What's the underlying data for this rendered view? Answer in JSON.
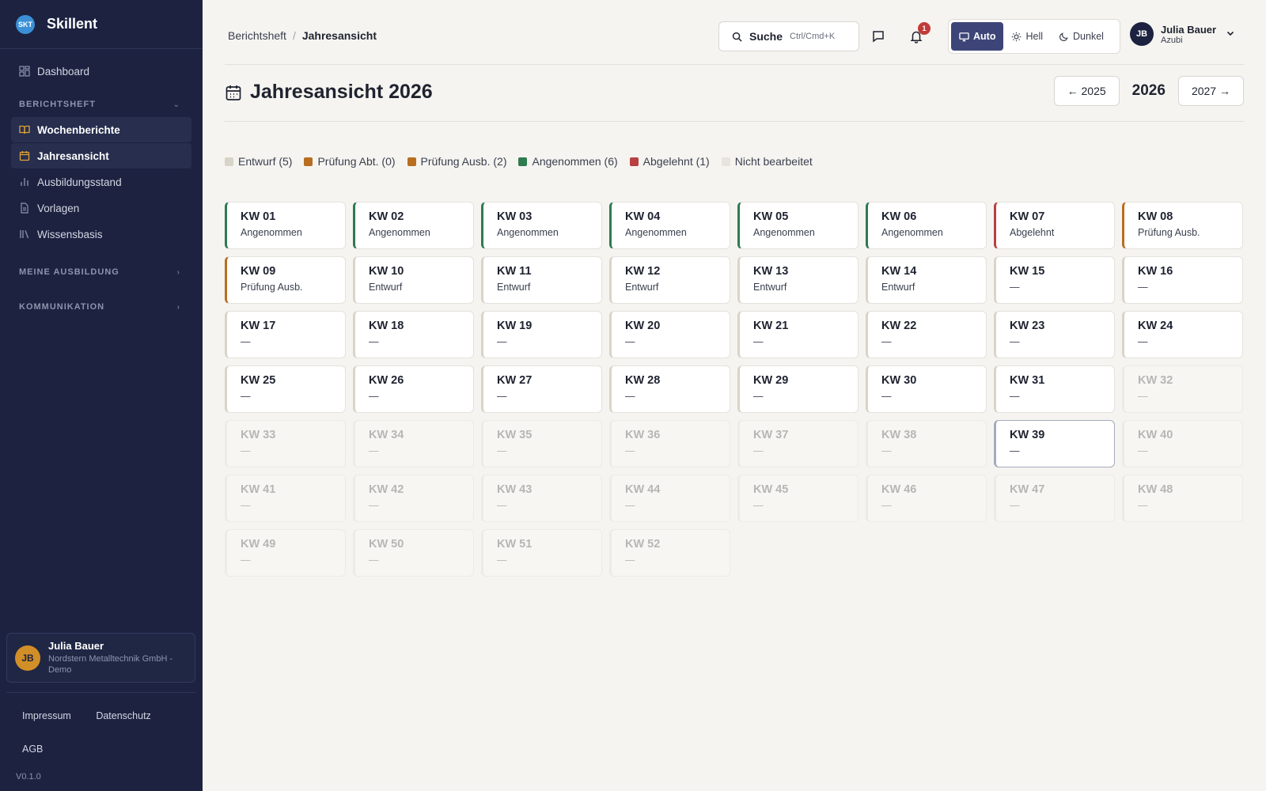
{
  "brand": {
    "logo": "SKT",
    "name": "Skillent"
  },
  "sidebar": {
    "dashboard": "Dashboard",
    "sections": [
      {
        "label": "BERICHTSHEFT",
        "items": [
          "Wochenberichte",
          "Jahresansicht",
          "Ausbildungsstand",
          "Vorlagen",
          "Wissensbasis"
        ]
      },
      {
        "label": "MEINE AUSBILDUNG"
      },
      {
        "label": "KOMMUNIKATION"
      }
    ],
    "user": {
      "initials": "JB",
      "name": "Julia Bauer",
      "org": "Nordstern Metalltechnik GmbH - Demo"
    },
    "footer": {
      "impressum": "Impressum",
      "datenschutz": "Datenschutz",
      "agb": "AGB",
      "version": "V0.1.0"
    }
  },
  "header": {
    "breadcrumb": [
      "Berichtsheft",
      "Jahresansicht"
    ],
    "search": {
      "label": "Suche",
      "shortcut": "Ctrl/Cmd+K"
    },
    "notifications_count": "1",
    "theme": {
      "options": [
        "Auto",
        "Hell",
        "Dunkel"
      ],
      "active": "Auto"
    },
    "profile": {
      "initials": "JB",
      "name": "Julia Bauer",
      "role": "Azubi"
    }
  },
  "page": {
    "title": "Jahresansicht 2026",
    "prev_year": "← 2025",
    "current_year": "2026",
    "next_year": "2027 →"
  },
  "colors": {
    "draft": "#d8d4c8",
    "review_dept": "#b86e20",
    "review_trainer": "#b86e20",
    "accepted": "#2f7a4f",
    "rejected": "#b84040",
    "none": "#e6e4dc"
  },
  "legend": [
    {
      "label": "Entwurf (5)",
      "color": "#d8d4c8"
    },
    {
      "label": "Prüfung Abt. (0)",
      "color": "#b86e20"
    },
    {
      "label": "Prüfung Ausb. (2)",
      "color": "#b86e20"
    },
    {
      "label": "Angenommen (6)",
      "color": "#2f7a4f"
    },
    {
      "label": "Abgelehnt (1)",
      "color": "#b84040"
    },
    {
      "label": "Nicht bearbeitet",
      "color": "#e6e4dc"
    }
  ],
  "weeks": [
    {
      "kw": "KW 01",
      "status": "Angenommen",
      "type": "accepted"
    },
    {
      "kw": "KW 02",
      "status": "Angenommen",
      "type": "accepted"
    },
    {
      "kw": "KW 03",
      "status": "Angenommen",
      "type": "accepted"
    },
    {
      "kw": "KW 04",
      "status": "Angenommen",
      "type": "accepted"
    },
    {
      "kw": "KW 05",
      "status": "Angenommen",
      "type": "accepted"
    },
    {
      "kw": "KW 06",
      "status": "Angenommen",
      "type": "accepted"
    },
    {
      "kw": "KW 07",
      "status": "Abgelehnt",
      "type": "rejected"
    },
    {
      "kw": "KW 08",
      "status": "Prüfung Ausb.",
      "type": "review"
    },
    {
      "kw": "KW 09",
      "status": "Prüfung Ausb.",
      "type": "review"
    },
    {
      "kw": "KW 10",
      "status": "Entwurf",
      "type": "draft"
    },
    {
      "kw": "KW 11",
      "status": "Entwurf",
      "type": "draft"
    },
    {
      "kw": "KW 12",
      "status": "Entwurf",
      "type": "draft"
    },
    {
      "kw": "KW 13",
      "status": "Entwurf",
      "type": "draft"
    },
    {
      "kw": "KW 14",
      "status": "Entwurf",
      "type": "draft"
    },
    {
      "kw": "KW 15",
      "status": "—",
      "type": "none"
    },
    {
      "kw": "KW 16",
      "status": "—",
      "type": "none"
    },
    {
      "kw": "KW 17",
      "status": "—",
      "type": "none"
    },
    {
      "kw": "KW 18",
      "status": "—",
      "type": "none"
    },
    {
      "kw": "KW 19",
      "status": "—",
      "type": "none"
    },
    {
      "kw": "KW 20",
      "status": "—",
      "type": "none"
    },
    {
      "kw": "KW 21",
      "status": "—",
      "type": "none"
    },
    {
      "kw": "KW 22",
      "status": "—",
      "type": "none"
    },
    {
      "kw": "KW 23",
      "status": "—",
      "type": "none"
    },
    {
      "kw": "KW 24",
      "status": "—",
      "type": "none"
    },
    {
      "kw": "KW 25",
      "status": "—",
      "type": "none"
    },
    {
      "kw": "KW 26",
      "status": "—",
      "type": "none"
    },
    {
      "kw": "KW 27",
      "status": "—",
      "type": "none"
    },
    {
      "kw": "KW 28",
      "status": "—",
      "type": "none"
    },
    {
      "kw": "KW 29",
      "status": "—",
      "type": "none"
    },
    {
      "kw": "KW 30",
      "status": "—",
      "type": "none"
    },
    {
      "kw": "KW 31",
      "status": "—",
      "type": "none"
    },
    {
      "kw": "KW 32",
      "status": "—",
      "type": "future"
    },
    {
      "kw": "KW 33",
      "status": "—",
      "type": "future"
    },
    {
      "kw": "KW 34",
      "status": "—",
      "type": "future"
    },
    {
      "kw": "KW 35",
      "status": "—",
      "type": "future"
    },
    {
      "kw": "KW 36",
      "status": "—",
      "type": "future"
    },
    {
      "kw": "KW 37",
      "status": "—",
      "type": "future"
    },
    {
      "kw": "KW 38",
      "status": "—",
      "type": "future"
    },
    {
      "kw": "KW 39",
      "status": "—",
      "type": "current"
    },
    {
      "kw": "KW 40",
      "status": "—",
      "type": "future"
    },
    {
      "kw": "KW 41",
      "status": "—",
      "type": "future"
    },
    {
      "kw": "KW 42",
      "status": "—",
      "type": "future"
    },
    {
      "kw": "KW 43",
      "status": "—",
      "type": "future"
    },
    {
      "kw": "KW 44",
      "status": "—",
      "type": "future"
    },
    {
      "kw": "KW 45",
      "status": "—",
      "type": "future"
    },
    {
      "kw": "KW 46",
      "status": "—",
      "type": "future"
    },
    {
      "kw": "KW 47",
      "status": "—",
      "type": "future"
    },
    {
      "kw": "KW 48",
      "status": "—",
      "type": "future"
    },
    {
      "kw": "KW 49",
      "status": "—",
      "type": "future"
    },
    {
      "kw": "KW 50",
      "status": "—",
      "type": "future"
    },
    {
      "kw": "KW 51",
      "status": "—",
      "type": "future"
    },
    {
      "kw": "KW 52",
      "status": "—",
      "type": "future"
    }
  ]
}
